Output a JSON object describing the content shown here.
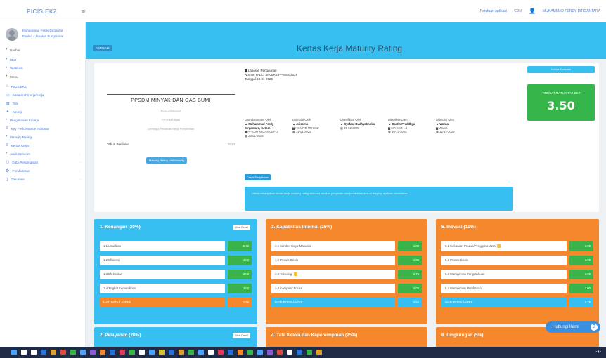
{
  "topbar": {
    "brand": "PICIS EKZ",
    "user_name": "MUHAMMAD FERDY DIRGANTARA",
    "links": [
      "Panduan Aplikasi",
      "CDN"
    ]
  },
  "sidebar": {
    "user_line1": "Muhammad Ferdy Dirgantar",
    "user_line2": "Eselon / Jabatan Fungsional",
    "items": [
      {
        "icon": "dot-icon",
        "label": "Navbar",
        "section": true
      },
      {
        "icon": "dot-icon",
        "label": "EKZ",
        "chevron": true
      },
      {
        "icon": "dot-icon",
        "label": "Verifikasi",
        "chevron": true
      },
      {
        "icon": "dot-icon",
        "label": "Menu",
        "section": true
      },
      {
        "icon": "home-icon",
        "label": "PICIS EKZ",
        "chevron": false
      },
      {
        "icon": "folder-icon",
        "label": "Sasaran Kinerja/Kerja",
        "chevron": true
      },
      {
        "icon": "book-icon",
        "label": "Tata",
        "chevron": true
      },
      {
        "icon": "chart-icon",
        "label": "Kinerja",
        "chevron": true
      },
      {
        "icon": "dot-icon",
        "label": "Pengelolaan Kinerja",
        "chevron": true
      },
      {
        "icon": "list-icon",
        "label": "Key Performance Indicator",
        "chevron": false
      },
      {
        "icon": "dot-icon",
        "label": "Maturity Rating",
        "chevron": true
      },
      {
        "icon": "list-icon",
        "label": "Kertas Kerja",
        "chevron": false
      },
      {
        "icon": "dot-icon",
        "label": "Audit Services",
        "chevron": true
      },
      {
        "icon": "users-icon",
        "label": "Data Pendingatan",
        "chevron": true
      },
      {
        "icon": "gear-icon",
        "label": "Pendaftaran",
        "chevron": true
      },
      {
        "icon": "doc-icon",
        "label": "Dokumen",
        "chevron": true
      }
    ]
  },
  "header": {
    "badge": "KEMBALI",
    "title": "Kertas Kerja Maturity Rating"
  },
  "card": {
    "org_name": "PPSDM MINYAK DAN GAS BUMI",
    "org_sub1": "BOS 2024/2025",
    "org_sub2": "PPSDM Migas",
    "org_sub3": "Lembaga Pelatihan Kerja Pemerintah",
    "year_label": "Tahun Penilaian",
    "year_value": "2024",
    "small_button": "Maturity Rating Unit Maturity",
    "info_line1": "Laporan Penggunan",
    "info_line2": "Nomor: B-1/LT.MR.EKZ/PPMSS/2025",
    "info_line3": "Tanggal 24-01-2025",
    "signers": [
      {
        "role": "Ditandatangani Oleh",
        "name": "Muhammad Ferdy Dirgantara, S.Kom",
        "id": "PPSDM MIGAS CEPU",
        "date": "28-01-2025"
      },
      {
        "role": "Disetujui Oleh",
        "name": "Arisoma",
        "id": "KOMITE MR EKZ",
        "date": "31-01-2025"
      },
      {
        "role": "Diverifikasi Oleh",
        "name": "Syafaat Budhyatmoko",
        "id": "",
        "date": "05-02-2025"
      },
      {
        "role": "Diperiksa Oleh",
        "name": "Dastin Pradithya",
        "id": "MR EKZ 1.4",
        "date": "10-12-2025"
      },
      {
        "role": "Disetujui Oleh",
        "name": "Warno",
        "id": "Warno",
        "date": "12-12-2025"
      }
    ],
    "print_button": "Cetak Penjelasan",
    "notice": "Untuk melanjutkan kertas kerja maturity rating silahkan lakukan pengisian dan pemberian sesuai lengkap aplikasi cleanliness.",
    "top_button": "Kertas Evaluasi",
    "maturity_label": "TINGKAT MATURITAS EKZ",
    "maturity_value": "3.50"
  },
  "panels": [
    {
      "title": "1. Keuangan (20%)",
      "color": "blue",
      "button": "Lihat Detail",
      "rows": [
        {
          "label": "1.1 Likuiditas",
          "value": "5.75"
        },
        {
          "label": "1.2 Efisiensi",
          "value": "4.00"
        },
        {
          "label": "1.3 Efektivitas",
          "value": "3.00"
        },
        {
          "label": "1.4 Tingkat Kemandirian",
          "value": "4.00"
        }
      ],
      "summary": {
        "label": "MATURITAS ASPEK",
        "value": "3.88",
        "style": "orange"
      }
    },
    {
      "title": "3. Kapabilitas Internal (25%)",
      "color": "orange",
      "button": "",
      "rows": [
        {
          "label": "3.1 Sumber Daya Manusia",
          "value": "4.00"
        },
        {
          "label": "3.2 Proses Bisnis",
          "value": "4.00"
        },
        {
          "label": "3.3 Teknologi",
          "value": "3.75"
        },
        {
          "label": "3.4 Company Focus",
          "value": "4.00"
        }
      ],
      "summary": {
        "label": "MATURITAS ASPEK",
        "value": "3.50",
        "style": "blue"
      }
    },
    {
      "title": "5. Inovasi (10%)",
      "color": "orange",
      "button": "",
      "rows": [
        {
          "label": "5.1 Kebaruan Produk/Pengguna Jasa",
          "value": "3.00"
        },
        {
          "label": "5.2 Proses Bisnis",
          "value": "3.00"
        },
        {
          "label": "5.3 Manajemen Pengetahuan",
          "value": "3.00"
        },
        {
          "label": "5.4 Manajemen Perubahan",
          "value": "3.00"
        }
      ],
      "summary": {
        "label": "MATURITAS ASPEK",
        "value": "2.75",
        "style": "blue"
      }
    },
    {
      "title": "2. Pelayanan (20%)",
      "color": "blue",
      "button": "Lihat Detail",
      "rows": [
        {
          "label": "2.1 Indeks Kepuasan Masyarakat",
          "value": "4.00"
        }
      ],
      "summary": null
    },
    {
      "title": "4. Tata Kelola dan Kepemimpinan (25%)",
      "color": "orange",
      "button": "",
      "rows": [
        {
          "label": "4.1 Kepemimpinan Strategis",
          "value": "4.00"
        }
      ],
      "summary": null
    },
    {
      "title": "6. Lingkungan (5%)",
      "color": "orange",
      "button": "",
      "rows": [
        {
          "label": "6.1 Environment Friendly Management",
          "value": "3.00"
        }
      ],
      "summary": null
    }
  ],
  "chat": {
    "label": "Hubungi Kami",
    "icon": "help-icon"
  }
}
